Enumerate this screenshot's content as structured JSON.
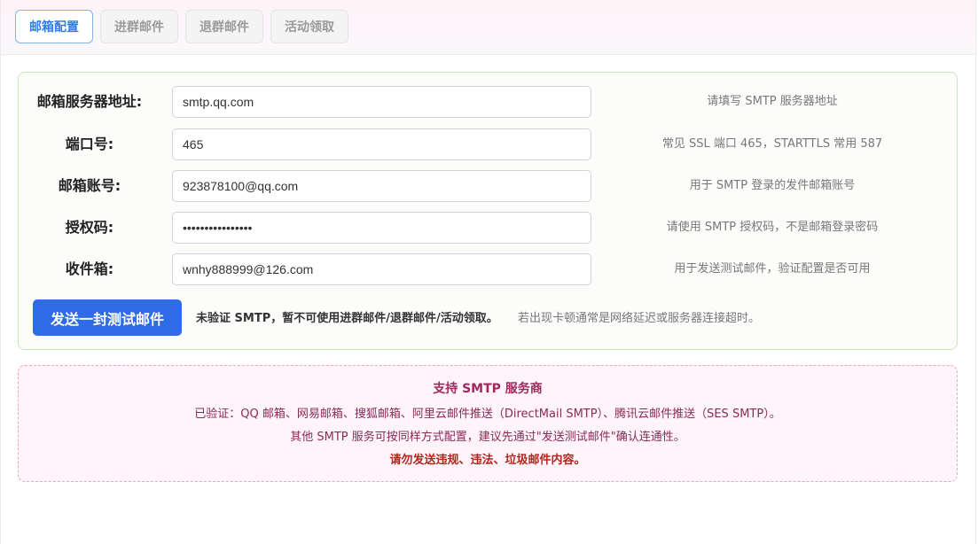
{
  "tabs": [
    {
      "label": "邮箱配置",
      "active": true
    },
    {
      "label": "进群邮件",
      "active": false
    },
    {
      "label": "退群邮件",
      "active": false
    },
    {
      "label": "活动领取",
      "active": false
    }
  ],
  "form": {
    "server": {
      "label": "邮箱服务器地址:",
      "value": "smtp.qq.com",
      "hint": "请填写 SMTP 服务器地址"
    },
    "port": {
      "label": "端口号:",
      "value": "465",
      "hint": "常见 SSL 端口 465，STARTTLS 常用 587"
    },
    "account": {
      "label": "邮箱账号:",
      "value": "923878100@qq.com",
      "hint": "用于 SMTP 登录的发件邮箱账号"
    },
    "auth_code": {
      "label": "授权码:",
      "value": "••••••••••••••••",
      "hint": "请使用 SMTP 授权码，不是邮箱登录密码"
    },
    "inbox": {
      "label": "收件箱:",
      "value": "wnhy888999@126.com",
      "hint": "用于发送测试邮件，验证配置是否可用"
    }
  },
  "actions": {
    "send_test_label": "发送一封测试邮件",
    "unverified_warning": "未验证 SMTP，暂不可使用进群邮件/退群邮件/活动领取。",
    "lag_tip": "若出现卡顿通常是网络延迟或服务器连接超时。"
  },
  "providers": {
    "title": "支持 SMTP 服务商",
    "verified": "已验证：QQ 邮箱、网易邮箱、搜狐邮箱、阿里云邮件推送（DirectMail SMTP）、腾讯云邮件推送（SES SMTP）。",
    "others": "其他 SMTP 服务可按同样方式配置，建议先通过\"发送测试邮件\"确认连通性。",
    "warning": "请勿发送违规、违法、垃圾邮件内容。"
  },
  "colors": {
    "accent": "#2e6be6",
    "active_tab": "#2f7de1",
    "card_border": "#cfe4b5",
    "provider_border": "#e7a7c6",
    "provider_title": "#a0285f",
    "danger": "#b3261e"
  }
}
